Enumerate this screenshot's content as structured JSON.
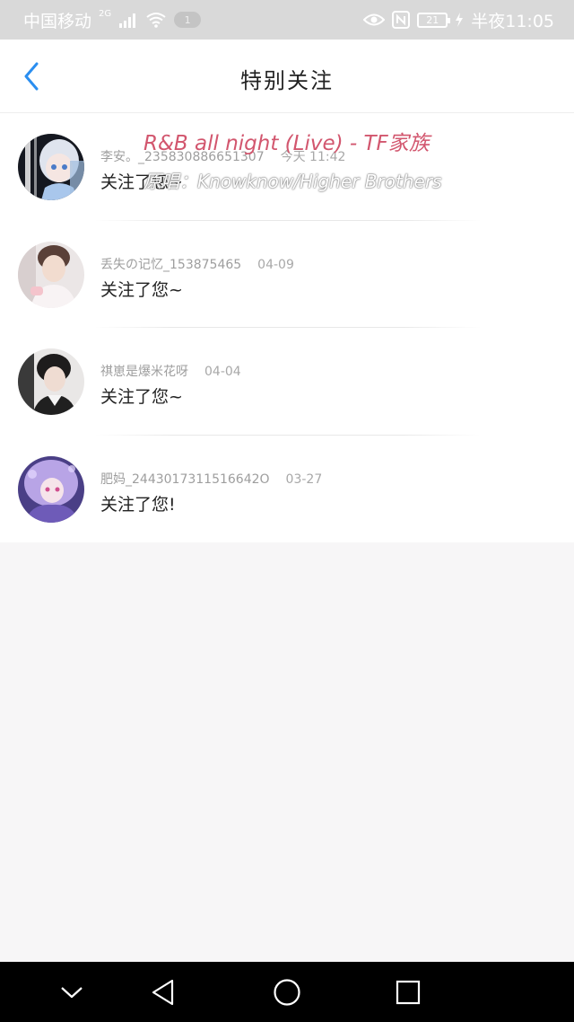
{
  "status_bar": {
    "carrier": "中国移动",
    "network": "2G",
    "pill_text": "1",
    "battery_level": "21",
    "time": "半夜11:05",
    "icons": [
      "signal-icon",
      "wifi-icon",
      "eye-icon",
      "nfc-icon",
      "battery-icon",
      "charging-icon"
    ]
  },
  "header": {
    "title": "特别关注",
    "back_icon": "back-chevron-icon",
    "accent_color": "#2a8ef0"
  },
  "items": [
    {
      "name": "李安。_235830886651307",
      "date": "今天 11:42",
      "message": "关注了您~"
    },
    {
      "name": "丢失の记忆_153875465",
      "date": "04-09",
      "message": "关注了您~"
    },
    {
      "name": "祺崽是爆米花呀",
      "date": "04-04",
      "message": "关注了您~"
    },
    {
      "name": "肥妈_2443017311516642O",
      "date": "03-27",
      "message": "关注了您!"
    }
  ],
  "lyric_overlay": {
    "line1": "R&B all night (Live) - TF家族",
    "line2": "原唱：Knowknow/Higher Brothers",
    "line1_color": "#d2566e"
  },
  "nav_bar": {
    "icons": [
      "collapse-down-icon",
      "back-triangle-icon",
      "home-circle-icon",
      "recents-square-icon"
    ]
  }
}
